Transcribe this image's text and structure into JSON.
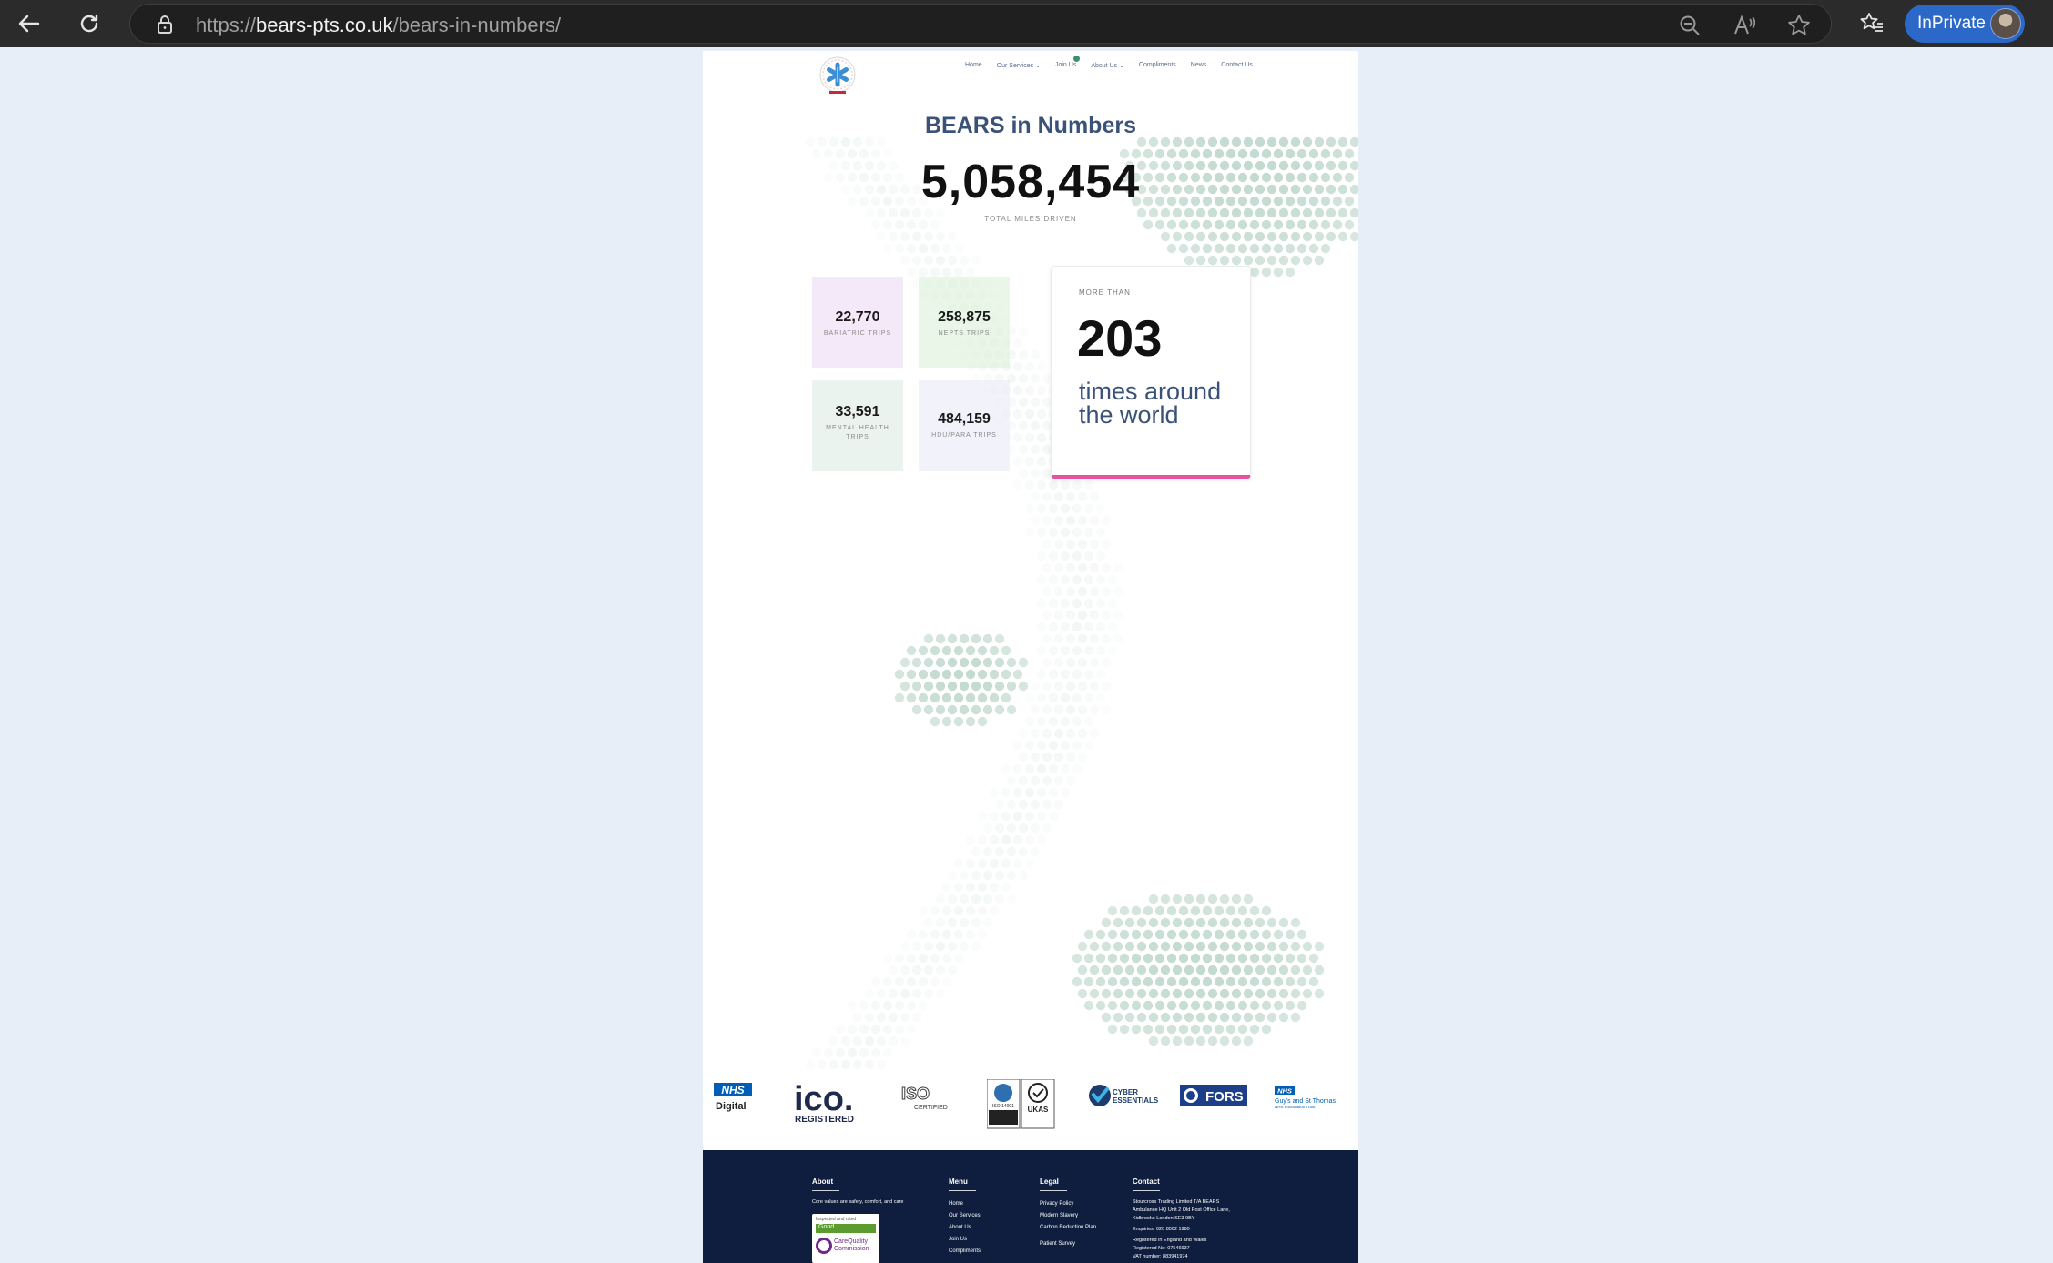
{
  "browser": {
    "url_prefix": "https://",
    "url_domain": "bears-pts.co.uk",
    "url_path": "/bears-in-numbers/",
    "inprivate_label": "InPrivate"
  },
  "nav": {
    "items": [
      "Home",
      "Our Services",
      "Join Us",
      "About Us",
      "Compliments",
      "News",
      "Contact Us"
    ]
  },
  "hero": {
    "title": "BEARS in Numbers",
    "total_miles": "5,058,454",
    "total_miles_caption": "TOTAL MILES DRIVEN"
  },
  "stats": [
    {
      "value": "22,770",
      "caption": "BARIATRIC TRIPS"
    },
    {
      "value": "258,875",
      "caption": "NEPTS TRIPS"
    },
    {
      "value": "33,591",
      "caption": "MENTAL HEALTH TRIPS"
    },
    {
      "value": "484,159",
      "caption": "HDU/PARA TRIPS"
    }
  ],
  "world_card": {
    "kicker": "MORE THAN",
    "number": "203",
    "text": "times around the world",
    "accent_color": "#e4549e"
  },
  "certifications": {
    "nhs_digital": {
      "nhs": "NHS",
      "sub": "Digital"
    },
    "ico": {
      "big": "ico.",
      "sub": "REGISTERED"
    },
    "iso": {
      "big": "ISO",
      "sub": "CERTIFIED"
    },
    "iso_ukas": {
      "left": "ISO 14001",
      "right": "UKAS"
    },
    "cyber": {
      "line1": "CYBER",
      "line2": "ESSENTIALS"
    },
    "fors": {
      "name": "FORS"
    },
    "guys": {
      "nhs": "NHS",
      "line1": "Guy's and St Thomas'",
      "line2": "NHS Foundation Trust"
    }
  },
  "footer": {
    "about": {
      "heading": "About",
      "tagline": "Core values are safety, comfort, and care",
      "cqc_inspected": "Inspected and rated",
      "cqc_rating": "Good",
      "cqc_name": "CareQuality Commission"
    },
    "menu": {
      "heading": "Menu",
      "links": [
        "Home",
        "Our Services",
        "About Us",
        "Join Us",
        "Compliments"
      ]
    },
    "legal": {
      "heading": "Legal",
      "links": [
        "Privacy Policy",
        "Modern Slavery",
        "Carbon Reduction Plan",
        "Patient Survey"
      ]
    },
    "contact": {
      "heading": "Contact",
      "lines": [
        "Stourcross Trading Limited T/A BEARS",
        "Ambulance HQ Unit 2 Old Post Office Lane,",
        "Kidbrooke London SE3 9BY",
        "Enquiries: 020 8002 1980",
        "Registered in England and Wales",
        "Registered No: 07546937",
        "VAT number: 883941974"
      ]
    }
  },
  "colors": {
    "page_bg": "#e8eef7",
    "title": "#3b5278",
    "footer_bg": "#0f1e3e",
    "map_dots": "#b9d4c8"
  }
}
